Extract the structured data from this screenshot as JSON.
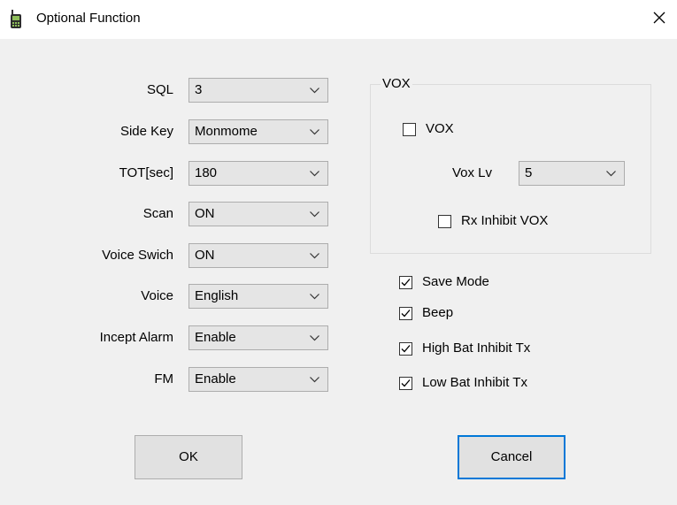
{
  "window": {
    "title": "Optional Function",
    "icon": "radio-icon",
    "close_icon": "close-icon"
  },
  "fields": [
    {
      "label": "SQL",
      "value": "3"
    },
    {
      "label": "Side Key",
      "value": "Monmome"
    },
    {
      "label": "TOT[sec]",
      "value": "180"
    },
    {
      "label": "Scan",
      "value": "ON"
    },
    {
      "label": "Voice Swich",
      "value": "ON"
    },
    {
      "label": "Voice",
      "value": "English"
    },
    {
      "label": "Incept Alarm",
      "value": "Enable"
    },
    {
      "label": "FM",
      "value": "Enable"
    }
  ],
  "vox": {
    "group_title": "VOX",
    "vox_label": "VOX",
    "vox_checked": false,
    "level_label": "Vox Lv",
    "level_value": "5",
    "rx_inhibit_label": "Rx Inhibit VOX",
    "rx_inhibit_checked": false
  },
  "options": [
    {
      "label": "Save Mode",
      "checked": true
    },
    {
      "label": "Beep",
      "checked": true
    },
    {
      "label": "High Bat Inhibit Tx",
      "checked": true
    },
    {
      "label": "Low Bat Inhibit Tx",
      "checked": true
    }
  ],
  "buttons": {
    "ok": "OK",
    "cancel": "Cancel"
  },
  "colors": {
    "focus_border": "#0078d7",
    "dialog_bg": "#f0f0f0"
  }
}
